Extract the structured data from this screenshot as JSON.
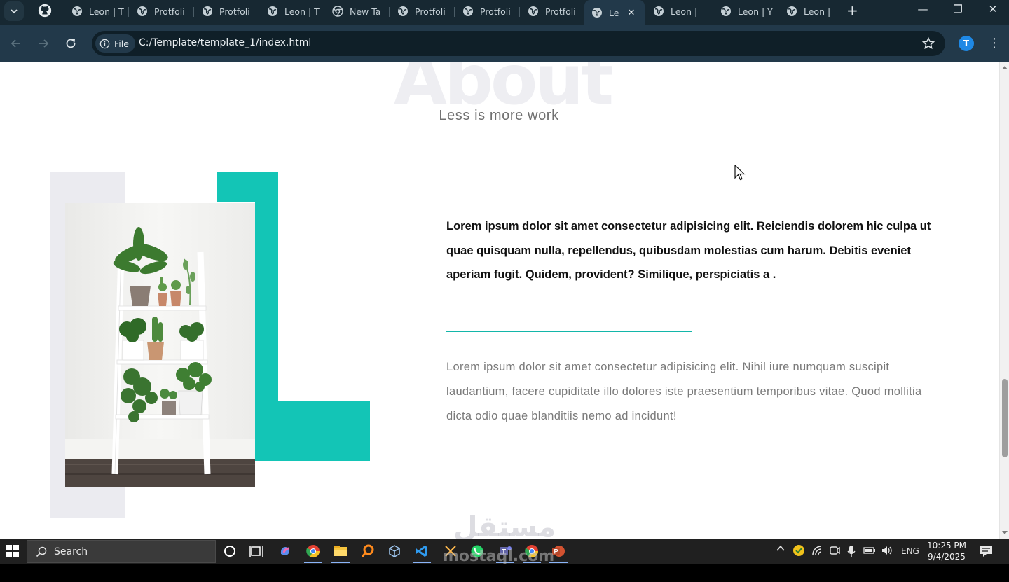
{
  "browser": {
    "tabs": [
      {
        "label": "Leon | T",
        "icon": "globe-icon"
      },
      {
        "label": "Protfoli",
        "icon": "globe-icon"
      },
      {
        "label": "Protfoli",
        "icon": "globe-icon"
      },
      {
        "label": "Leon | T",
        "icon": "globe-icon"
      },
      {
        "label": "New Ta",
        "icon": "chrome-icon"
      },
      {
        "label": "Protfoli",
        "icon": "globe-icon"
      },
      {
        "label": "Protfoli",
        "icon": "globe-icon"
      },
      {
        "label": "Protfoli",
        "icon": "globe-icon"
      },
      {
        "label": "Le",
        "icon": "globe-icon",
        "active": true
      },
      {
        "label": "Leon | ",
        "icon": "globe-icon"
      },
      {
        "label": "Leon | Y",
        "icon": "globe-icon"
      },
      {
        "label": "Leon | ",
        "icon": "globe-icon"
      }
    ],
    "scheme_label": "File",
    "url": "C:/Template/template_1/index.html",
    "profile_initial": "T"
  },
  "page": {
    "about_heading": "About",
    "about_subtitle": "Less is more work",
    "lead_text": "Lorem ipsum dolor sit amet consectetur adipisicing elit. Reiciendis dolorem hic culpa ut quae quisquam nulla, repellendus, quibusdam molestias cum harum. Debitis eveniet aperiam fugit. Quidem, provident? Similique, perspiciatis a .",
    "body_text": "Lorem ipsum dolor sit amet consectetur adipisicing elit. Nihil iure numquam suscipit laudantium, facere cupiditate illo dolores iste praesentium temporibus vitae. Quod mollitia dicta odio quae blanditiis nemo ad incidunt!",
    "accent_color": "#13c5b6"
  },
  "taskbar": {
    "search_label": "Search",
    "language": "ENG",
    "time": "10:25 PM",
    "date": "9/4/2025"
  },
  "watermark": {
    "arabic": "مستقل",
    "latin": "mostaql.com"
  }
}
